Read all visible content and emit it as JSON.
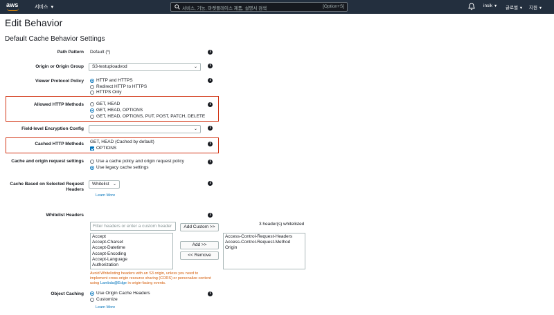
{
  "nav": {
    "logo": "aws",
    "services": "서비스",
    "search_placeholder": "서비스, 기능, 마켓플레이스 제품, 설명서 검색",
    "search_shortcut": "[Option+S]",
    "user": "insik",
    "region": "글로벌",
    "support": "지원",
    "caret": "▼"
  },
  "page_title": "Edit Behavior",
  "section_title": "Default Cache Behavior Settings",
  "rows": {
    "path_pattern": {
      "label": "Path Pattern",
      "value": "Default (*)"
    },
    "origin": {
      "label": "Origin or Origin Group",
      "value": "S3-testuploadvod"
    },
    "viewer_protocol": {
      "label": "Viewer Protocol Policy",
      "options": [
        "HTTP and HTTPS",
        "Redirect HTTP to HTTPS",
        "HTTPS Only"
      ],
      "selected": 0
    },
    "allowed_methods": {
      "label": "Allowed HTTP Methods",
      "options": [
        "GET, HEAD",
        "GET, HEAD, OPTIONS",
        "GET, HEAD, OPTIONS, PUT, POST, PATCH, DELETE"
      ],
      "selected": 1
    },
    "field_encryption": {
      "label": "Field-level Encryption Config",
      "value": ""
    },
    "cached_methods": {
      "label": "Cached HTTP Methods",
      "text": "GET, HEAD (Cached by default)",
      "checkbox_label": "OPTIONS",
      "checked": true
    },
    "cache_settings": {
      "label": "Cache and origin request settings",
      "options": [
        "Use a cache policy and origin request policy",
        "Use legacy cache settings"
      ],
      "selected": 1
    },
    "cache_headers": {
      "label": "Cache Based on Selected Request Headers",
      "value": "Whitelist",
      "learn_more": "Learn More"
    },
    "whitelist_headers": {
      "label": "Whitelist Headers",
      "filter_placeholder": "Filter headers or enter a custom header",
      "add_custom": "Add Custom >>",
      "add": "Add >>",
      "remove": "<< Remove",
      "count_text": "3 header(s) whitelisted",
      "available": [
        "Accept",
        "Accept-Charset",
        "Accept-Datetime",
        "Accept-Encoding",
        "Accept-Language",
        "Authorization"
      ],
      "selected_headers": [
        "Access-Control-Request-Headers",
        "Access-Control-Request-Method",
        "Origin"
      ],
      "warning_pre": "Avoid Whitelisting headers with an S3 origin, unless you need to implement cross-origin resource sharing (CORS) or personalize content using ",
      "warning_link": "Lambda@Edge",
      "warning_post": " in origin-facing events."
    },
    "object_caching": {
      "label": "Object Caching",
      "options": [
        "Use Origin Cache Headers",
        "Customize"
      ],
      "selected": 0,
      "learn_more": "Learn More"
    }
  },
  "info_glyph": "i",
  "colors": {
    "nav_bg": "#232f3e",
    "accent": "#0073bb",
    "highlight_box": "#d13212",
    "warning": "#d45b07",
    "aws_orange": "#ff9900"
  }
}
